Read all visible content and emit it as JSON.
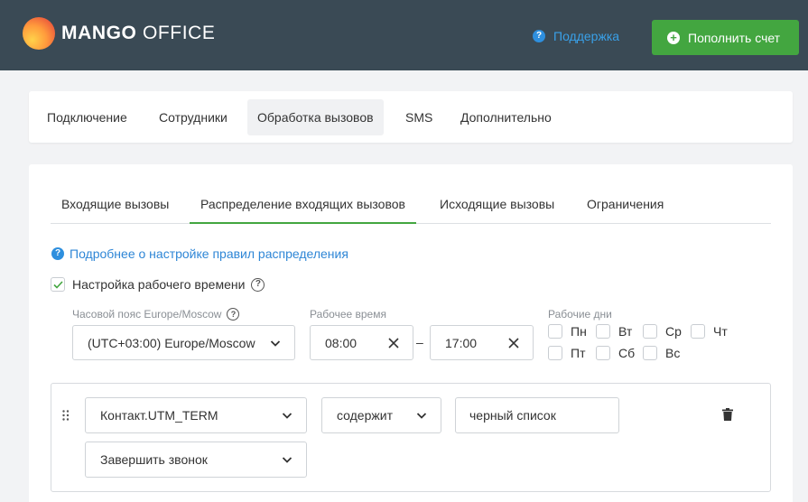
{
  "header": {
    "logo_bold": "MANGO",
    "logo_light": "OFFICE",
    "support_label": "Поддержка",
    "topup_label": "Пополнить счет"
  },
  "main_nav": {
    "items": [
      "Подключение",
      "Сотрудники",
      "Обработка вызовов",
      "SMS",
      "Дополнительно"
    ],
    "active": "Обработка вызовов"
  },
  "tabs": {
    "items": [
      "Входящие вызовы",
      "Распределение входящих вызовов",
      "Исходящие вызовы",
      "Ограничения"
    ],
    "active": "Распределение входящих вызовов"
  },
  "more_link": "Подробнее о настройке правил распределения",
  "work_time": {
    "label": "Настройка рабочего времени",
    "checked": true,
    "timezone_label": "Часовой пояс Europe/Moscow",
    "timezone_value": "(UTC+03:00) Europe/Moscow",
    "hours_label": "Рабочее время",
    "from": "08:00",
    "separator": "–",
    "to": "17:00",
    "days_label": "Рабочие дни",
    "days": [
      "Пн",
      "Вт",
      "Ср",
      "Чт",
      "Пт",
      "Сб",
      "Вс"
    ]
  },
  "rule": {
    "field": "Контакт.UTM_TERM",
    "operator": "содержит",
    "value": "черный список",
    "action": "Завершить звонок"
  },
  "colors": {
    "header_bg": "#3a4a55",
    "accent_green": "#43a640",
    "link_blue": "#2e86d6"
  }
}
